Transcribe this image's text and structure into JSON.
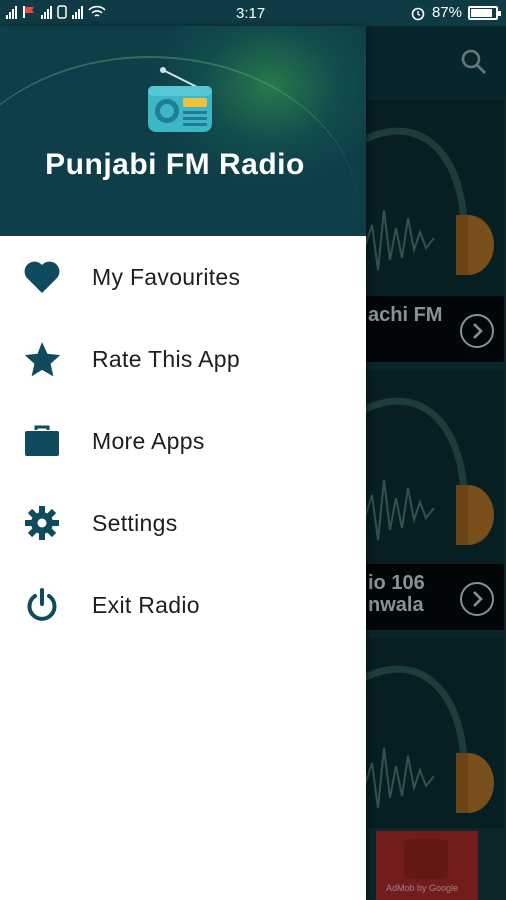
{
  "status_bar": {
    "time": "3:17",
    "battery_percent": "87%",
    "battery_level": 0.87
  },
  "app": {
    "cards": [
      {
        "caption": "achi FM"
      },
      {
        "caption": "io 106\nnwala"
      },
      {
        "caption": ""
      }
    ],
    "ad": {
      "text": "AdMob by Google"
    }
  },
  "drawer": {
    "title": "Punjabi FM Radio",
    "items": [
      {
        "label": "My Favourites",
        "icon": "heart-icon"
      },
      {
        "label": "Rate This App",
        "icon": "star-icon"
      },
      {
        "label": "More Apps",
        "icon": "briefcase-icon"
      },
      {
        "label": "Settings",
        "icon": "gear-icon"
      },
      {
        "label": "Exit Radio",
        "icon": "power-icon"
      }
    ]
  },
  "colors": {
    "accent": "#0f4b5c",
    "header_bg": "#0e3e48",
    "status_bar": "#0f3b44"
  }
}
